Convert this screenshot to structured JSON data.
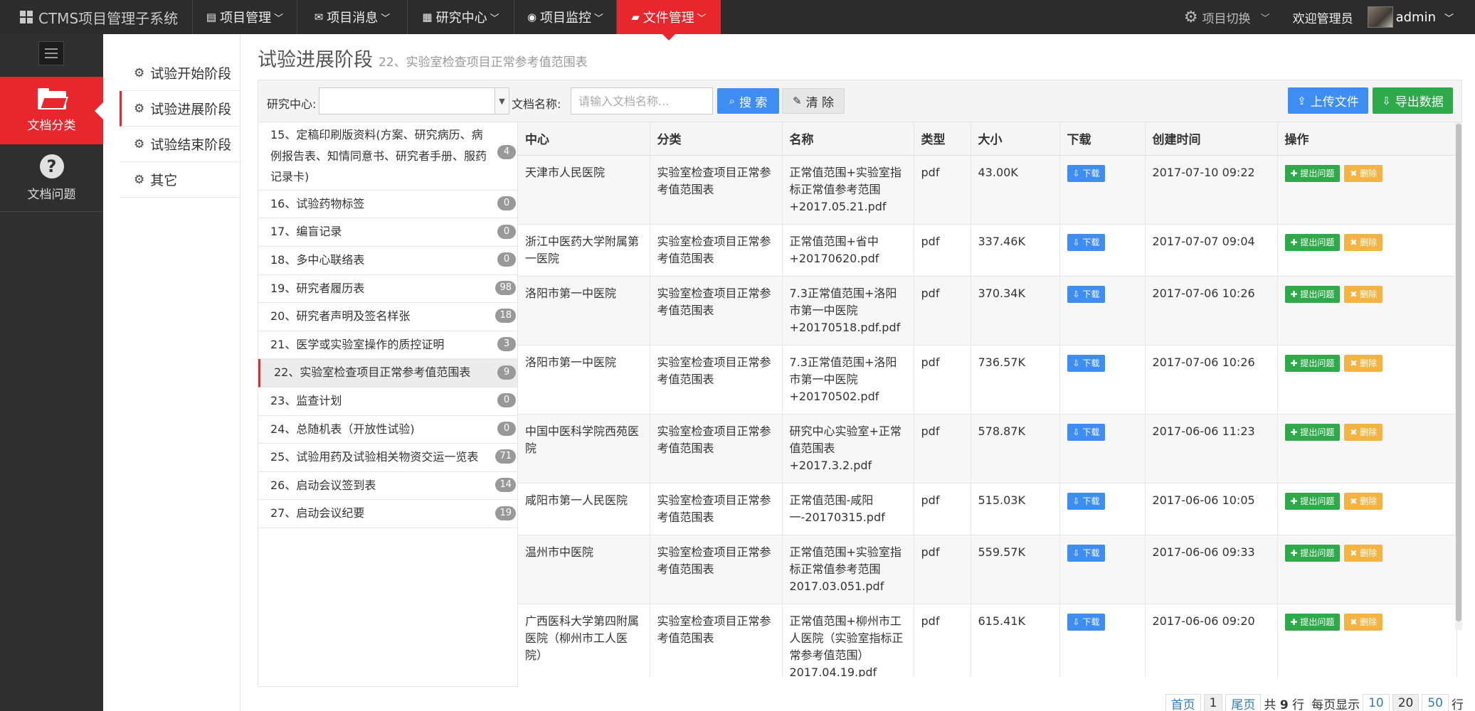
{
  "navbar": {
    "brand": "CTMS项目管理子系统",
    "menu": [
      {
        "label": "项目管理",
        "icon": "list-icon",
        "glyph": "▤"
      },
      {
        "label": "项目消息",
        "icon": "chat-icon",
        "glyph": "✉"
      },
      {
        "label": "研究中心",
        "icon": "building-icon",
        "glyph": "▦"
      },
      {
        "label": "项目监控",
        "icon": "eye-icon",
        "glyph": "◉"
      },
      {
        "label": "文件管理",
        "icon": "folder-icon",
        "glyph": "▰"
      }
    ],
    "project_switch": "项目切换",
    "welcome": "欢迎管理员",
    "username": "admin"
  },
  "sidebar": {
    "items": [
      {
        "label": "文档分类",
        "icon": "folder-open-icon"
      },
      {
        "label": "文档问题",
        "icon": "question-circle-icon"
      }
    ]
  },
  "stages": [
    {
      "label": "试验开始阶段"
    },
    {
      "label": "试验进展阶段"
    },
    {
      "label": "试验结束阶段"
    },
    {
      "label": "其它"
    }
  ],
  "page": {
    "title": "试验进展阶段",
    "subtitle": "22、实验室检查项目正常参考值范围表"
  },
  "search": {
    "center_label": "研究中心:",
    "center_value": "",
    "docname_label": "文档名称:",
    "docname_placeholder": "请输入文档名称...",
    "search_label": "搜 索",
    "clear_label": "清 除",
    "upload_label": "上传文件",
    "export_label": "导出数据"
  },
  "doc_types": [
    {
      "label": "15、定稿印刷版资料(方案、研究病历、病例报告表、知情同意书、研究者手册、服药记录卡)",
      "count": "4"
    },
    {
      "label": "16、试验药物标签",
      "count": "0"
    },
    {
      "label": "17、编盲记录",
      "count": "0"
    },
    {
      "label": "18、多中心联络表",
      "count": "0"
    },
    {
      "label": "19、研究者履历表",
      "count": "98"
    },
    {
      "label": "20、研究者声明及签名样张",
      "count": "18"
    },
    {
      "label": "21、医学或实验室操作的质控证明",
      "count": "3"
    },
    {
      "label": "22、实验室检查项目正常参考值范围表",
      "count": "9"
    },
    {
      "label": "23、监查计划",
      "count": "0"
    },
    {
      "label": "24、总随机表（开放性试验)",
      "count": "0"
    },
    {
      "label": "25、试验用药及试验相关物资交运一览表",
      "count": "71"
    },
    {
      "label": "26、启动会议签到表",
      "count": "14"
    },
    {
      "label": "27、启动会议纪要",
      "count": "19"
    }
  ],
  "table": {
    "headers": [
      "中心",
      "分类",
      "名称",
      "类型",
      "大小",
      "下载",
      "创建时间",
      "操作"
    ],
    "download_label": "下载",
    "question_label": "提出问题",
    "delete_label": "删除",
    "rows": [
      {
        "center": "天津市人民医院",
        "category": "实验室检查项目正常参考值范围表",
        "name": "正常值范围+实验室指标正常值参考范围+2017.05.21.pdf",
        "type": "pdf",
        "size": "43.00K",
        "created": "2017-07-10 09:22"
      },
      {
        "center": "浙江中医药大学附属第一医院",
        "category": "实验室检查项目正常参考值范围表",
        "name": "正常值范围+省中+20170620.pdf",
        "type": "pdf",
        "size": "337.46K",
        "created": "2017-07-07 09:04"
      },
      {
        "center": "洛阳市第一中医院",
        "category": "实验室检查项目正常参考值范围表",
        "name": "7.3正常值范围+洛阳市第一中医院+20170518.pdf.pdf",
        "type": "pdf",
        "size": "370.34K",
        "created": "2017-07-06 10:26"
      },
      {
        "center": "洛阳市第一中医院",
        "category": "实验室检查项目正常参考值范围表",
        "name": "7.3正常值范围+洛阳市第一中医院+20170502.pdf",
        "type": "pdf",
        "size": "736.57K",
        "created": "2017-07-06 10:26"
      },
      {
        "center": "中国中医科学院西苑医院",
        "category": "实验室检查项目正常参考值范围表",
        "name": "研究中心实验室+正常值范围表+2017.3.2.pdf",
        "type": "pdf",
        "size": "578.87K",
        "created": "2017-06-06 11:23"
      },
      {
        "center": "咸阳市第一人民医院",
        "category": "实验室检查项目正常参考值范围表",
        "name": "正常值范围-咸阳一-20170315.pdf",
        "type": "pdf",
        "size": "515.03K",
        "created": "2017-06-06 10:05"
      },
      {
        "center": "温州市中医院",
        "category": "实验室检查项目正常参考值范围表",
        "name": "正常值范围+实验室指标正常值参考范围2017.03.051.pdf",
        "type": "pdf",
        "size": "559.57K",
        "created": "2017-06-06 09:33"
      },
      {
        "center": "广西医科大学第四附属医院（柳州市工人医院）",
        "category": "实验室检查项目正常参考值范围表",
        "name": "正常值范围+柳州市工人医院（实验室指标正常参考值范围）2017.04.19.pdf",
        "type": "pdf",
        "size": "615.41K",
        "created": "2017-06-06 09:20"
      }
    ]
  },
  "pagination": {
    "first": "首页",
    "current": "1",
    "last": "尾页",
    "total_prefix": "共",
    "total": "9",
    "total_suffix": "行",
    "per_page_label": "每页显示",
    "sizes": [
      "10",
      "20",
      "50"
    ],
    "selected_size": "20",
    "per_page_suffix": "行"
  }
}
